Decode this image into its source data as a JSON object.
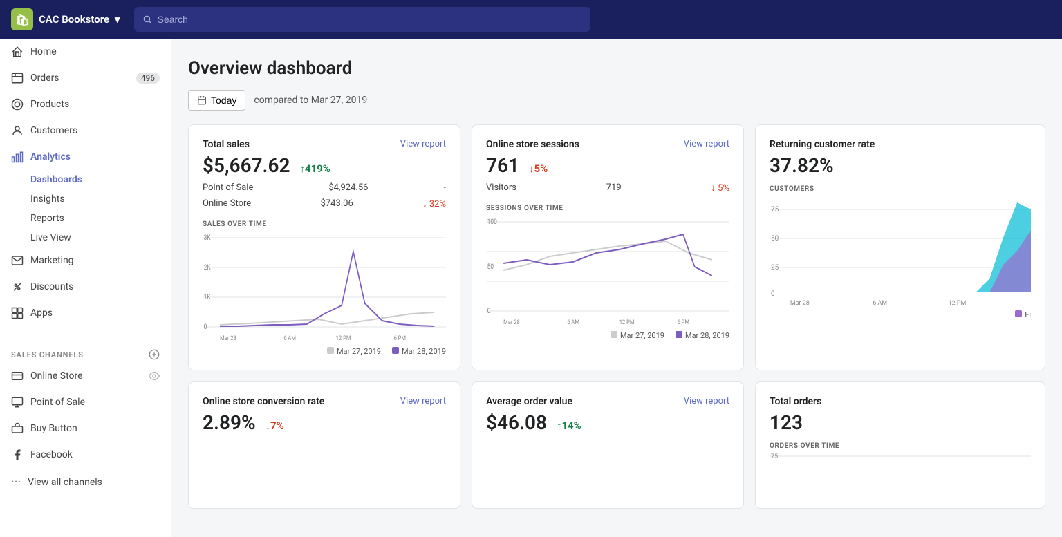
{
  "topNav": {
    "storeName": "CAC Bookstore",
    "searchPlaceholder": "Search",
    "chevron": "▾"
  },
  "sidebar": {
    "items": [
      {
        "id": "home",
        "label": "Home",
        "icon": "home",
        "badge": null,
        "active": false
      },
      {
        "id": "orders",
        "label": "Orders",
        "icon": "orders",
        "badge": "496",
        "active": false
      },
      {
        "id": "products",
        "label": "Products",
        "icon": "products",
        "badge": null,
        "active": false
      },
      {
        "id": "customers",
        "label": "Customers",
        "icon": "customers",
        "badge": null,
        "active": false
      },
      {
        "id": "analytics",
        "label": "Analytics",
        "icon": "analytics",
        "badge": null,
        "active": true
      }
    ],
    "analyticsSubItems": [
      {
        "id": "dashboards",
        "label": "Dashboards",
        "active": true
      },
      {
        "id": "insights",
        "label": "Insights",
        "active": false
      },
      {
        "id": "reports",
        "label": "Reports",
        "active": false
      },
      {
        "id": "live-view",
        "label": "Live View",
        "active": false
      }
    ],
    "otherItems": [
      {
        "id": "marketing",
        "label": "Marketing",
        "icon": "marketing"
      },
      {
        "id": "discounts",
        "label": "Discounts",
        "icon": "discounts"
      },
      {
        "id": "apps",
        "label": "Apps",
        "icon": "apps"
      }
    ],
    "salesChannelsTitle": "SALES CHANNELS",
    "salesChannels": [
      {
        "id": "online-store",
        "label": "Online Store"
      },
      {
        "id": "point-of-sale",
        "label": "Point of Sale"
      },
      {
        "id": "buy-button",
        "label": "Buy Button"
      },
      {
        "id": "facebook",
        "label": "Facebook"
      }
    ],
    "viewAllChannels": "View all channels"
  },
  "dashboard": {
    "title": "Overview dashboard",
    "dateButton": "Today",
    "comparedText": "compared to Mar 27, 2019",
    "cards": {
      "totalSales": {
        "title": "Total sales",
        "viewReport": "View report",
        "value": "$5,667.62",
        "change": "↑419%",
        "changeType": "up",
        "rows": [
          {
            "label": "Point of Sale",
            "value": "$4,924.56",
            "change": "-"
          },
          {
            "label": "Online Store",
            "value": "$743.06",
            "change": "↓ 32%"
          }
        ],
        "chartLabel": "SALES OVER TIME",
        "legend1": "Mar 27, 2019",
        "legend2": "Mar 28, 2019"
      },
      "onlineSessions": {
        "title": "Online store sessions",
        "viewReport": "View report",
        "value": "761",
        "change": "↓5%",
        "changeType": "down",
        "rows": [
          {
            "label": "Visitors",
            "value": "719",
            "change": "↓ 5%"
          }
        ],
        "chartLabel": "SESSIONS OVER TIME",
        "legend1": "Mar 27, 2019",
        "legend2": "Mar 28, 2019"
      },
      "returningRate": {
        "title": "Returning customer rate",
        "value": "37.82%",
        "customersLabel": "CUSTOMERS"
      },
      "conversionRate": {
        "title": "Online store conversion rate",
        "viewReport": "View report",
        "value": "2.89%",
        "change": "↓7%",
        "changeType": "down"
      },
      "avgOrderValue": {
        "title": "Average order value",
        "viewReport": "View report",
        "value": "$46.08",
        "change": "↑14%",
        "changeType": "up"
      },
      "totalOrders": {
        "title": "Total orders",
        "value": "123",
        "ordersLabel": "ORDERS OVER TIME"
      }
    }
  }
}
